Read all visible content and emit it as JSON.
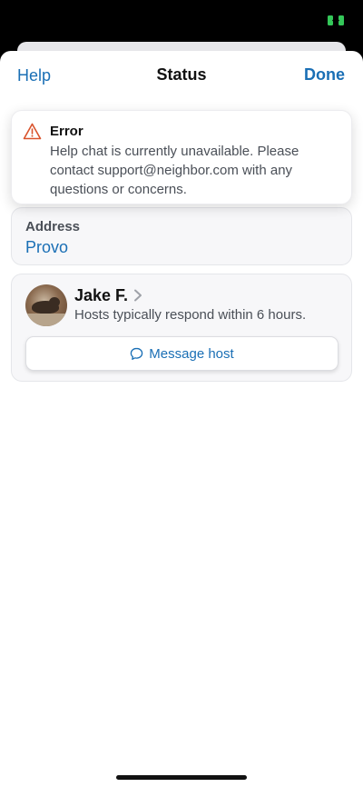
{
  "nav": {
    "help_label": "Help",
    "title": "Status",
    "done_label": "Done"
  },
  "toast": {
    "title": "Error",
    "message": "Help chat is currently unavailable. Please contact support@neighbor.com with any questions or concerns.",
    "icon": "warning-icon",
    "accent_color": "#d9532c"
  },
  "address": {
    "label": "Address",
    "value": "Provo"
  },
  "host": {
    "name": "Jake F.",
    "response_note": "Hosts typically respond within 6 hours.",
    "message_button_label": "Message host",
    "avatar_icon": "avatar"
  },
  "colors": {
    "link": "#1a6fb5",
    "battery": "#34c759"
  }
}
